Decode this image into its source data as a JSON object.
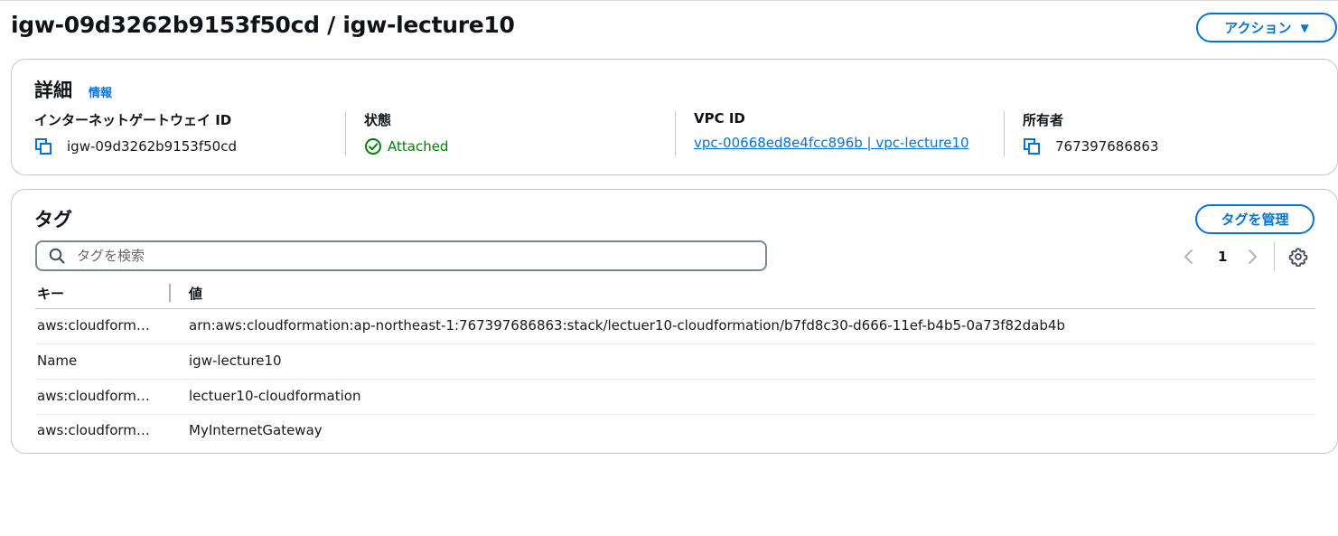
{
  "header": {
    "title": "igw-09d3262b9153f50cd / igw-lecture10",
    "actions_label": "アクション",
    "actions_caret": "▼"
  },
  "details": {
    "heading": "詳細",
    "info_link": "情報",
    "columns": {
      "igw_id": {
        "label": "インターネットゲートウェイ ID",
        "value": "igw-09d3262b9153f50cd",
        "icon": "copy-icon"
      },
      "state": {
        "label": "状態",
        "value": "Attached",
        "icon": "status-ok-icon"
      },
      "vpc_id": {
        "label": "VPC ID",
        "value": "vpc-00668ed8e4fcc896b | vpc-lecture10"
      },
      "owner": {
        "label": "所有者",
        "value": "767397686863",
        "icon": "copy-icon"
      }
    }
  },
  "tags": {
    "heading": "タグ",
    "manage_label": "タグを管理",
    "search_placeholder": "タグを検索",
    "pagination": {
      "current_page": "1",
      "prev_icon": "chevron-left-icon",
      "next_icon": "chevron-right-icon",
      "settings_icon": "gear-icon"
    },
    "columns": {
      "key": "キー",
      "value": "値"
    },
    "rows": [
      {
        "key": "aws:cloudformation:stack-id",
        "value": "arn:aws:cloudformation:ap-northeast-1:767397686863:stack/lectuer10-cloudformation/b7fd8c30-d666-11ef-b4b5-0a73f82dab4b"
      },
      {
        "key": "Name",
        "value": "igw-lecture10"
      },
      {
        "key": "aws:cloudformation:stack-name",
        "value": "lectuer10-cloudformation"
      },
      {
        "key": "aws:cloudformation:logical-id",
        "value": "MyInternetGateway"
      }
    ]
  },
  "colors": {
    "link": "#0972d3",
    "success": "#037f0c",
    "text": "#16191f",
    "border": "#c6c6cd"
  }
}
